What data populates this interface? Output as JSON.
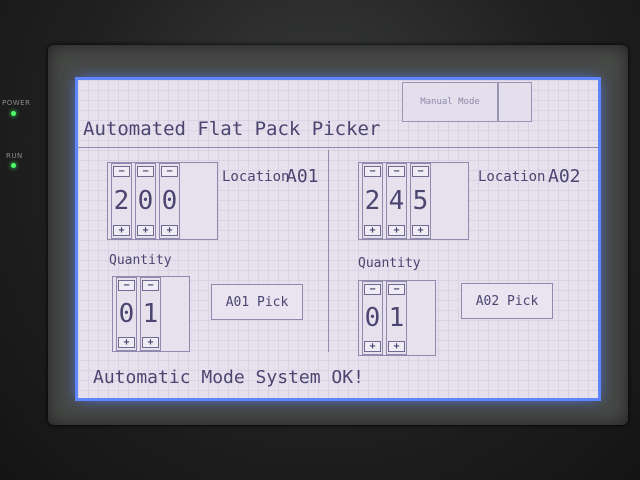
{
  "hardware": {
    "power_led_label": "POWER",
    "run_led_label": "RUN",
    "led_color": "#4cff6a"
  },
  "screen": {
    "title": "Automated Flat Pack Picker",
    "top_tabs": [
      "Manual Mode",
      ""
    ],
    "status": "Automatic Mode System OK!",
    "accent_color": "#5f86ff",
    "text_color": "#4a4670"
  },
  "stations": [
    {
      "location_label": "Location",
      "location_code": "A01",
      "location_digits": [
        "2",
        "0",
        "0"
      ],
      "quantity_label": "Quantity",
      "quantity_digits": [
        "0",
        "1"
      ],
      "pick_button_label": "A01 Pick"
    },
    {
      "location_label": "Location",
      "location_code": "A02",
      "location_digits": [
        "2",
        "4",
        "5"
      ],
      "quantity_label": "Quantity",
      "quantity_digits": [
        "0",
        "1"
      ],
      "pick_button_label": "A02 Pick"
    }
  ],
  "controls": {
    "decrement_symbol": "−",
    "increment_symbol": "+"
  }
}
